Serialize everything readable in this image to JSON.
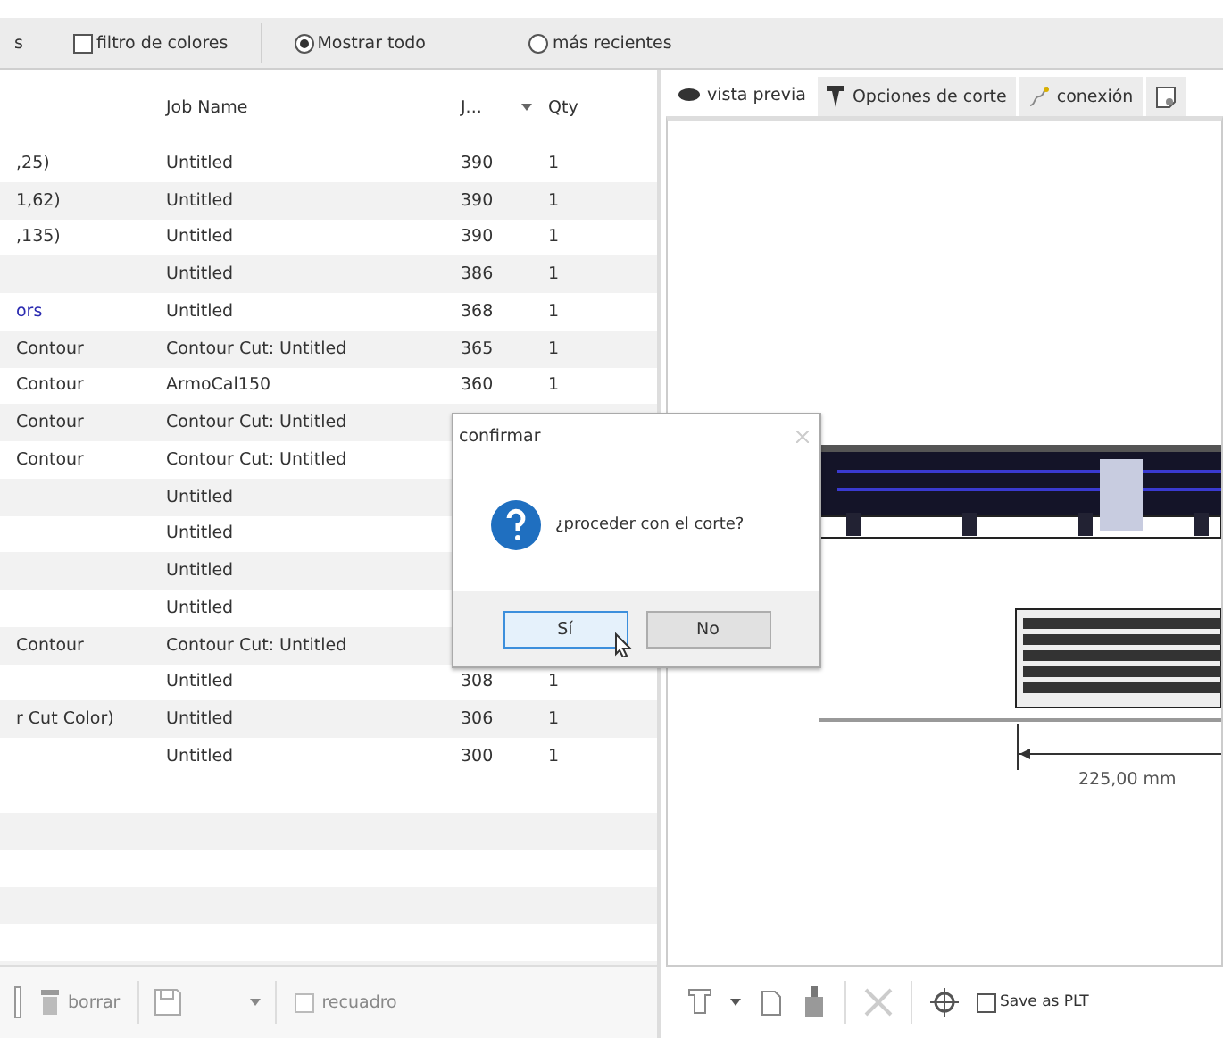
{
  "filter_bar": {
    "cut_label": "s",
    "color_filter": {
      "label": "filtro de colores",
      "checked": false
    },
    "radios": [
      {
        "label": "Mostrar todo",
        "selected": true
      },
      {
        "label": "más recientes",
        "selected": false
      }
    ]
  },
  "job_table": {
    "columns": [
      "Job Name",
      "J...",
      "Qty"
    ],
    "rows": [
      {
        "column_1": ",25)",
        "job_name": "Untitled",
        "column_3": "390",
        "qty": "1",
        "kind": "job"
      },
      {
        "column_1": "1,62)",
        "job_name": "Untitled",
        "column_3": "390",
        "qty": "1",
        "kind": "job"
      },
      {
        "column_1": ",135)",
        "job_name": "Untitled",
        "column_3": "390",
        "qty": "1",
        "kind": "job"
      },
      {
        "job_name": "Untitled",
        "column_3": "386",
        "qty": "1"
      },
      {
        "column_1": "ors",
        "job_name": "Untitled",
        "column_3": "368",
        "qty": "1",
        "kind": "link"
      },
      {
        "column_1": "Contour",
        "job_name": "Contour Cut: Untitled",
        "column_3": "365",
        "qty": "1",
        "kind": "job"
      },
      {
        "column_1": "Contour",
        "job_name": "ArmoCal150",
        "column_3": "360",
        "qty": "1",
        "kind": "job"
      },
      {
        "column_1": "Contour",
        "job_name": "Contour Cut: Untitled",
        "kind": "job"
      },
      {
        "column_1": "Contour",
        "job_name": "Contour Cut: Untitled",
        "kind": "job"
      },
      {
        "job_name": "Untitled"
      },
      {
        "job_name": "Untitled"
      },
      {
        "job_name": "Untitled"
      },
      {
        "job_name": "Untitled"
      },
      {
        "column_1": "Contour",
        "job_name": "Contour Cut: Untitled",
        "kind": "job"
      },
      {
        "job_name": "Untitled",
        "column_3": "308",
        "qty": "1"
      },
      {
        "column_1": "r Cut Color)",
        "job_name": "Untitled",
        "column_3": "306",
        "qty": "1",
        "kind": "job"
      },
      {
        "job_name": "Untitled",
        "column_3": "300",
        "qty": "1"
      }
    ]
  },
  "job_toolbar": {
    "delete_label": "borrar",
    "frame_checkbox": {
      "label": "recuadro",
      "checked": false
    }
  },
  "tabs": [
    {
      "label": "vista previa",
      "kind": "eye",
      "selected": true
    },
    {
      "label": "Opciones de corte",
      "kind": "cutter",
      "selected": false
    },
    {
      "label": "conexión",
      "kind": "cable",
      "selected": false
    },
    {
      "kind": "sheet",
      "selected": false
    }
  ],
  "preview": {
    "dimension": "225,00 mm"
  },
  "preview_toolbar": {
    "save_plt": {
      "label": "Save as PLT",
      "checked": false
    }
  },
  "dialog": {
    "title": "confirmar",
    "message": "¿proceder con el corte?",
    "buttons": [
      {
        "label": "Sí",
        "focused": true
      },
      {
        "label": "No",
        "focused": false
      }
    ]
  }
}
